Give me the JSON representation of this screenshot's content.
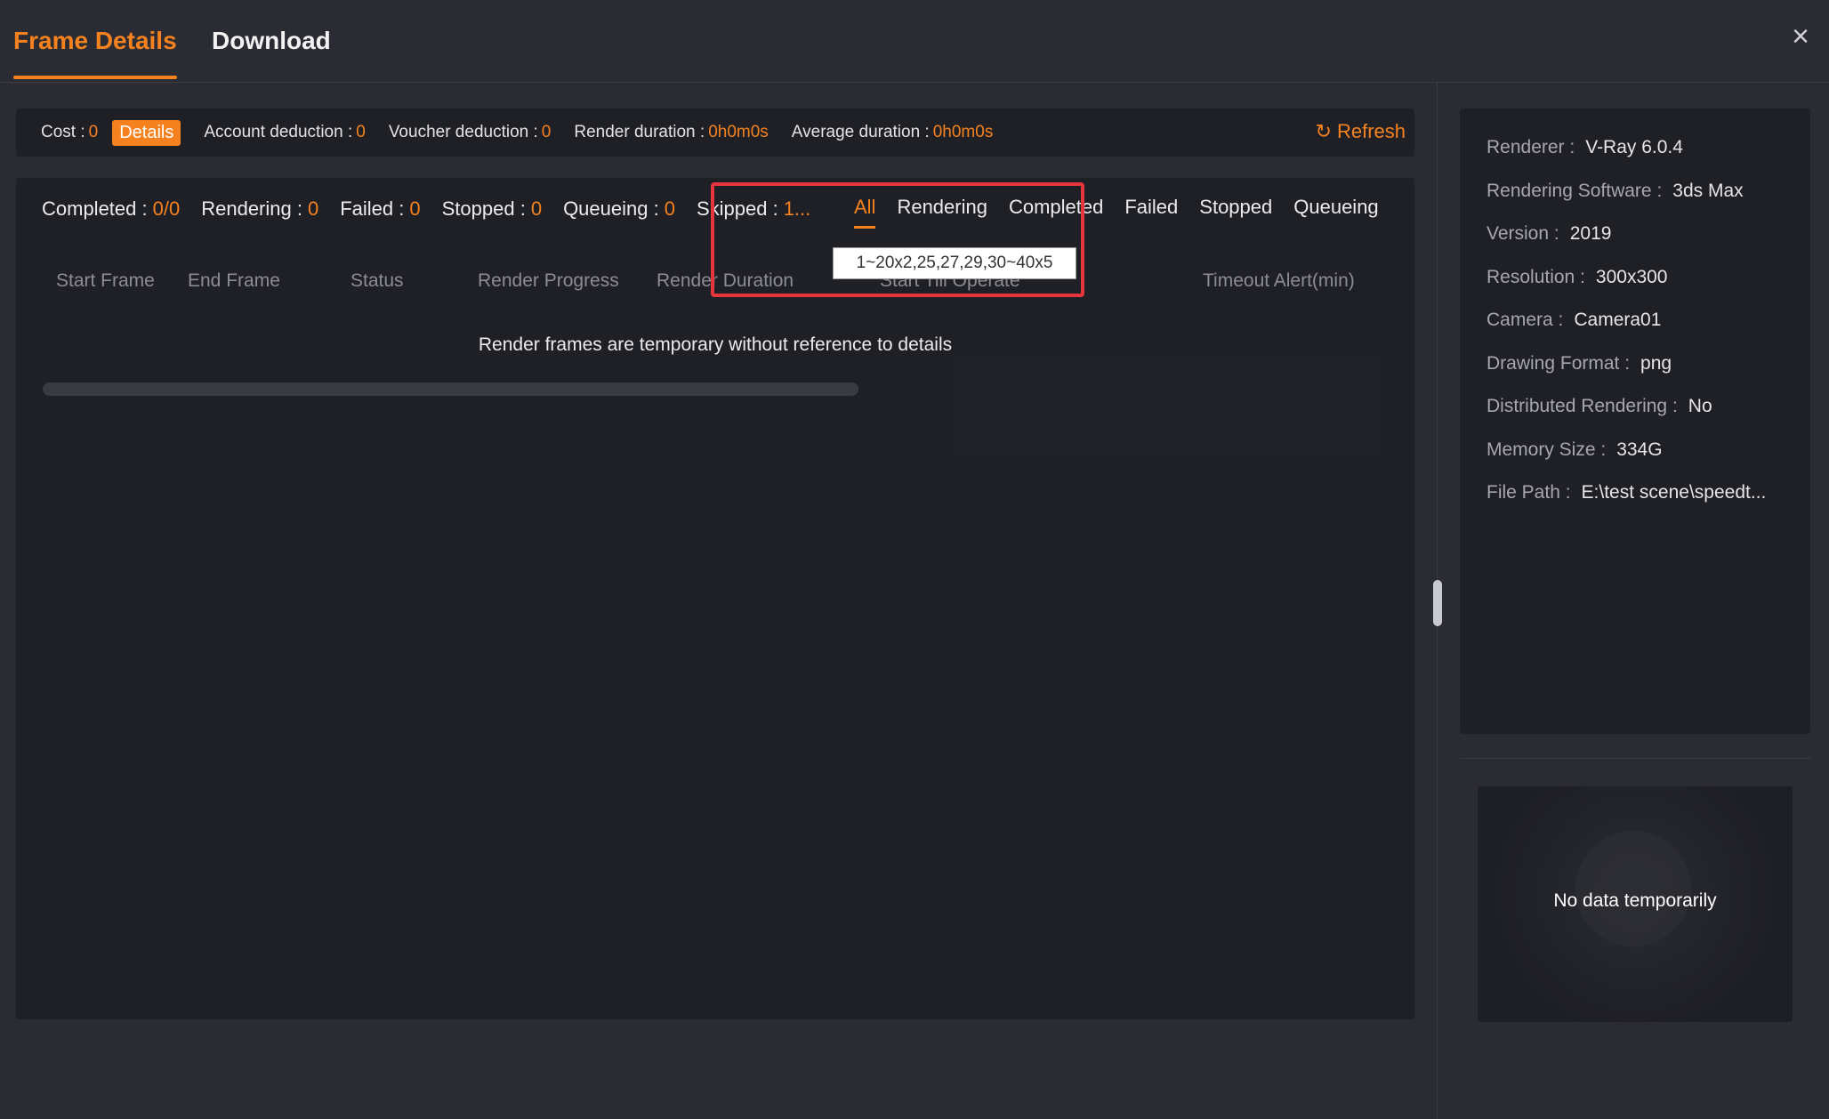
{
  "tabs": {
    "frame_details": "Frame Details",
    "download": "Download"
  },
  "close_icon": "×",
  "summary": {
    "cost_label": "Cost :",
    "cost_value": "0",
    "details_button": "Details",
    "account_deduction_label": "Account deduction :",
    "account_deduction_value": "0",
    "voucher_deduction_label": "Voucher deduction :",
    "voucher_deduction_value": "0",
    "render_duration_label": "Render duration :",
    "render_duration_value": "0h0m0s",
    "average_duration_label": "Average duration :",
    "average_duration_value": "0h0m0s",
    "refresh_label": "Refresh",
    "refresh_icon": "↻"
  },
  "counts": {
    "completed_label": "Completed :",
    "completed_value": "0/0",
    "rendering_label": "Rendering :",
    "rendering_value": "0",
    "failed_label": "Failed :",
    "failed_value": "0",
    "stopped_label": "Stopped :",
    "stopped_value": "0",
    "queueing_label": "Queueing :",
    "queueing_value": "0",
    "skipped_label": "Skipped :",
    "skipped_value": "1..."
  },
  "filters": {
    "all": "All",
    "rendering": "Rendering",
    "completed": "Completed",
    "failed": "Failed",
    "stopped": "Stopped",
    "queueing": "Queueing"
  },
  "tooltip": "1~20x2,25,27,29,30~40x5",
  "columns": {
    "start_frame": "Start Frame",
    "end_frame": "End Frame",
    "status": "Status",
    "render_progress": "Render Progress",
    "render_duration": "Render Duration",
    "start_till_operate": "Start Till Operate",
    "timeout_alert": "Timeout Alert(min)"
  },
  "empty_message": "Render frames are temporary without reference to details",
  "info": {
    "renderer_label": "Renderer :",
    "renderer_value": "V-Ray 6.0.4",
    "software_label": "Rendering Software :",
    "software_value": "3ds Max",
    "version_label": "Version :",
    "version_value": "2019",
    "resolution_label": "Resolution :",
    "resolution_value": "300x300",
    "camera_label": "Camera :",
    "camera_value": "Camera01",
    "format_label": "Drawing Format :",
    "format_value": "png",
    "distributed_label": "Distributed Rendering :",
    "distributed_value": "No",
    "memory_label": "Memory Size :",
    "memory_value": "334G",
    "filepath_label": "File Path :",
    "filepath_value": "E:\\test scene\\speedt..."
  },
  "preview": {
    "no_data": "No data temporarily"
  }
}
